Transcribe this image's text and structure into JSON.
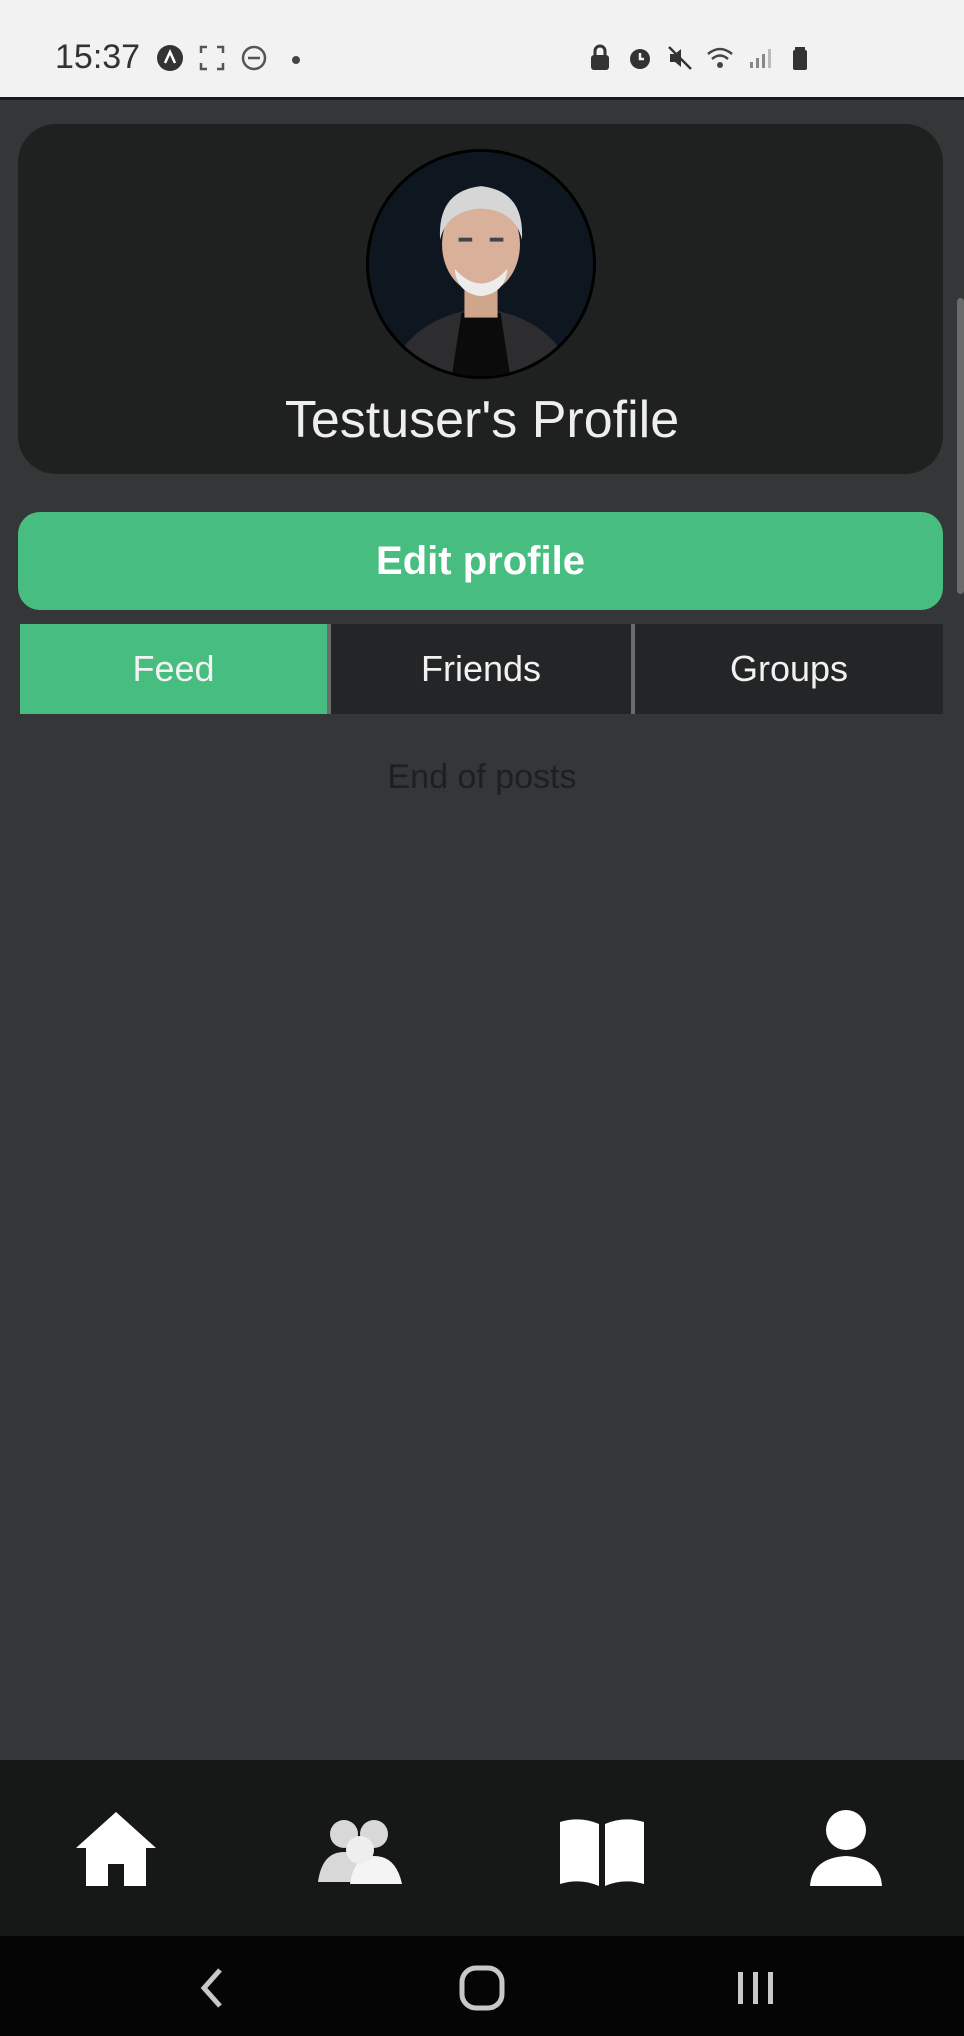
{
  "status_bar": {
    "time": "15:37",
    "left_icons": [
      "app-icon",
      "screenshot-frame-icon",
      "do-not-disturb-icon",
      "notification-dot-icon"
    ],
    "right_icons": [
      "lock-icon",
      "alarm-icon",
      "mute-icon",
      "wifi-icon",
      "signal-icon",
      "battery-icon"
    ]
  },
  "profile": {
    "title": "Testuser's Profile",
    "avatar": "avatar"
  },
  "edit_button": {
    "label": "Edit profile"
  },
  "tabs": [
    {
      "label": "Feed",
      "active": true
    },
    {
      "label": "Friends",
      "active": false
    },
    {
      "label": "Groups",
      "active": false
    }
  ],
  "feed": {
    "end_text": "End of posts"
  },
  "bottom_nav": [
    {
      "icon": "home-icon"
    },
    {
      "icon": "friends-icon"
    },
    {
      "icon": "book-icon"
    },
    {
      "icon": "profile-icon"
    }
  ],
  "system_nav": [
    "back-icon",
    "home-circle-icon",
    "recents-icon"
  ],
  "colors": {
    "accent": "#47bd80",
    "background": "#353638",
    "card": "#1f2020",
    "nav_bar": "#161717"
  }
}
